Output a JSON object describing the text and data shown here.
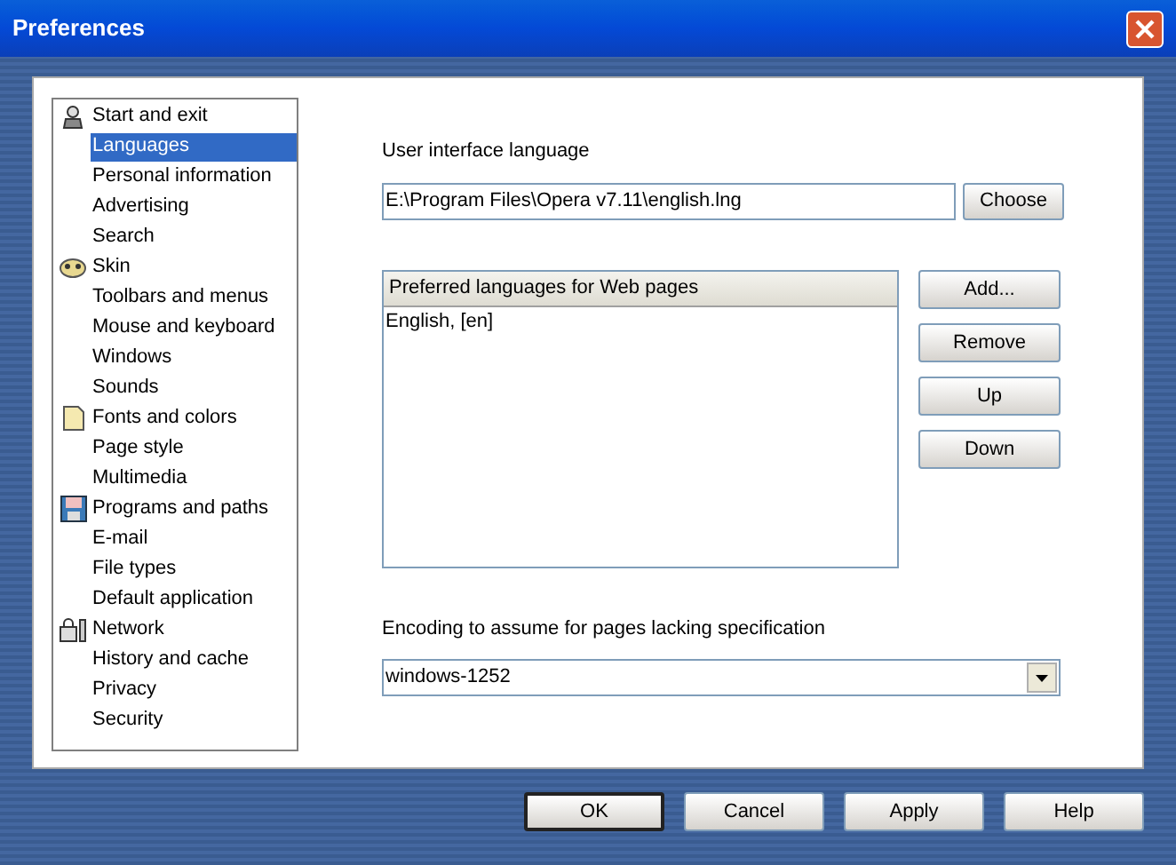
{
  "window": {
    "title": "Preferences"
  },
  "sidebar": {
    "items": [
      {
        "label": "Start and exit",
        "kind": "category",
        "selected": false
      },
      {
        "label": "Languages",
        "kind": "page",
        "selected": true
      },
      {
        "label": "Personal information",
        "kind": "page",
        "selected": false
      },
      {
        "label": "Advertising",
        "kind": "page",
        "selected": false
      },
      {
        "label": "Search",
        "kind": "page",
        "selected": false
      },
      {
        "label": "Skin",
        "kind": "category",
        "selected": false
      },
      {
        "label": "Toolbars and menus",
        "kind": "page",
        "selected": false
      },
      {
        "label": "Mouse and keyboard",
        "kind": "page",
        "selected": false
      },
      {
        "label": "Windows",
        "kind": "page",
        "selected": false
      },
      {
        "label": "Sounds",
        "kind": "page",
        "selected": false
      },
      {
        "label": "Fonts and colors",
        "kind": "category",
        "selected": false
      },
      {
        "label": "Page style",
        "kind": "page",
        "selected": false
      },
      {
        "label": "Multimedia",
        "kind": "page",
        "selected": false
      },
      {
        "label": "Programs and paths",
        "kind": "category",
        "selected": false
      },
      {
        "label": "E-mail",
        "kind": "page",
        "selected": false
      },
      {
        "label": "File types",
        "kind": "page",
        "selected": false
      },
      {
        "label": "Default application",
        "kind": "page",
        "selected": false
      },
      {
        "label": "Network",
        "kind": "category",
        "selected": false
      },
      {
        "label": "History and cache",
        "kind": "page",
        "selected": false
      },
      {
        "label": "Privacy",
        "kind": "page",
        "selected": false
      },
      {
        "label": "Security",
        "kind": "page",
        "selected": false
      }
    ]
  },
  "ui_language": {
    "label": "User interface language",
    "value": "E:\\Program Files\\Opera v7.11\\english.lng",
    "button": "Choose"
  },
  "preferred_languages": {
    "header": "Preferred languages for Web pages",
    "rows": [
      "English, [en]"
    ],
    "buttons": [
      "Add...",
      "Remove",
      "Up",
      "Down"
    ]
  },
  "encoding": {
    "label": "Encoding to assume for pages lacking specification",
    "value": "windows-1252"
  },
  "buttons": [
    "OK",
    "Cancel",
    "Apply",
    "Help"
  ]
}
